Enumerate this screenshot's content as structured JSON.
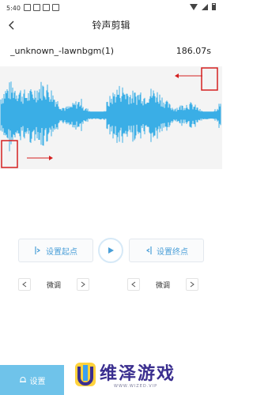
{
  "status_bar": {
    "time": "5:40"
  },
  "header": {
    "title": "铃声剪辑"
  },
  "file": {
    "name": "_unknown_-lawnbgm(1)",
    "duration": "186.07s"
  },
  "waveform": {
    "color": "#3aaee6",
    "marker_color": "#d42020",
    "start_marker": 0.0,
    "end_marker": 1.0
  },
  "controls": {
    "set_start_label": "设置起点",
    "set_end_label": "设置终点",
    "fine_tune_start_label": "微调",
    "fine_tune_end_label": "微调"
  },
  "bottom": {
    "settings_label": "设置",
    "watermark_title": "维泽游戏",
    "watermark_sub": "WWW.WIZED.VIP"
  },
  "colors": {
    "accent": "#4a9fd8",
    "tab_bg": "#6fc3ea"
  }
}
